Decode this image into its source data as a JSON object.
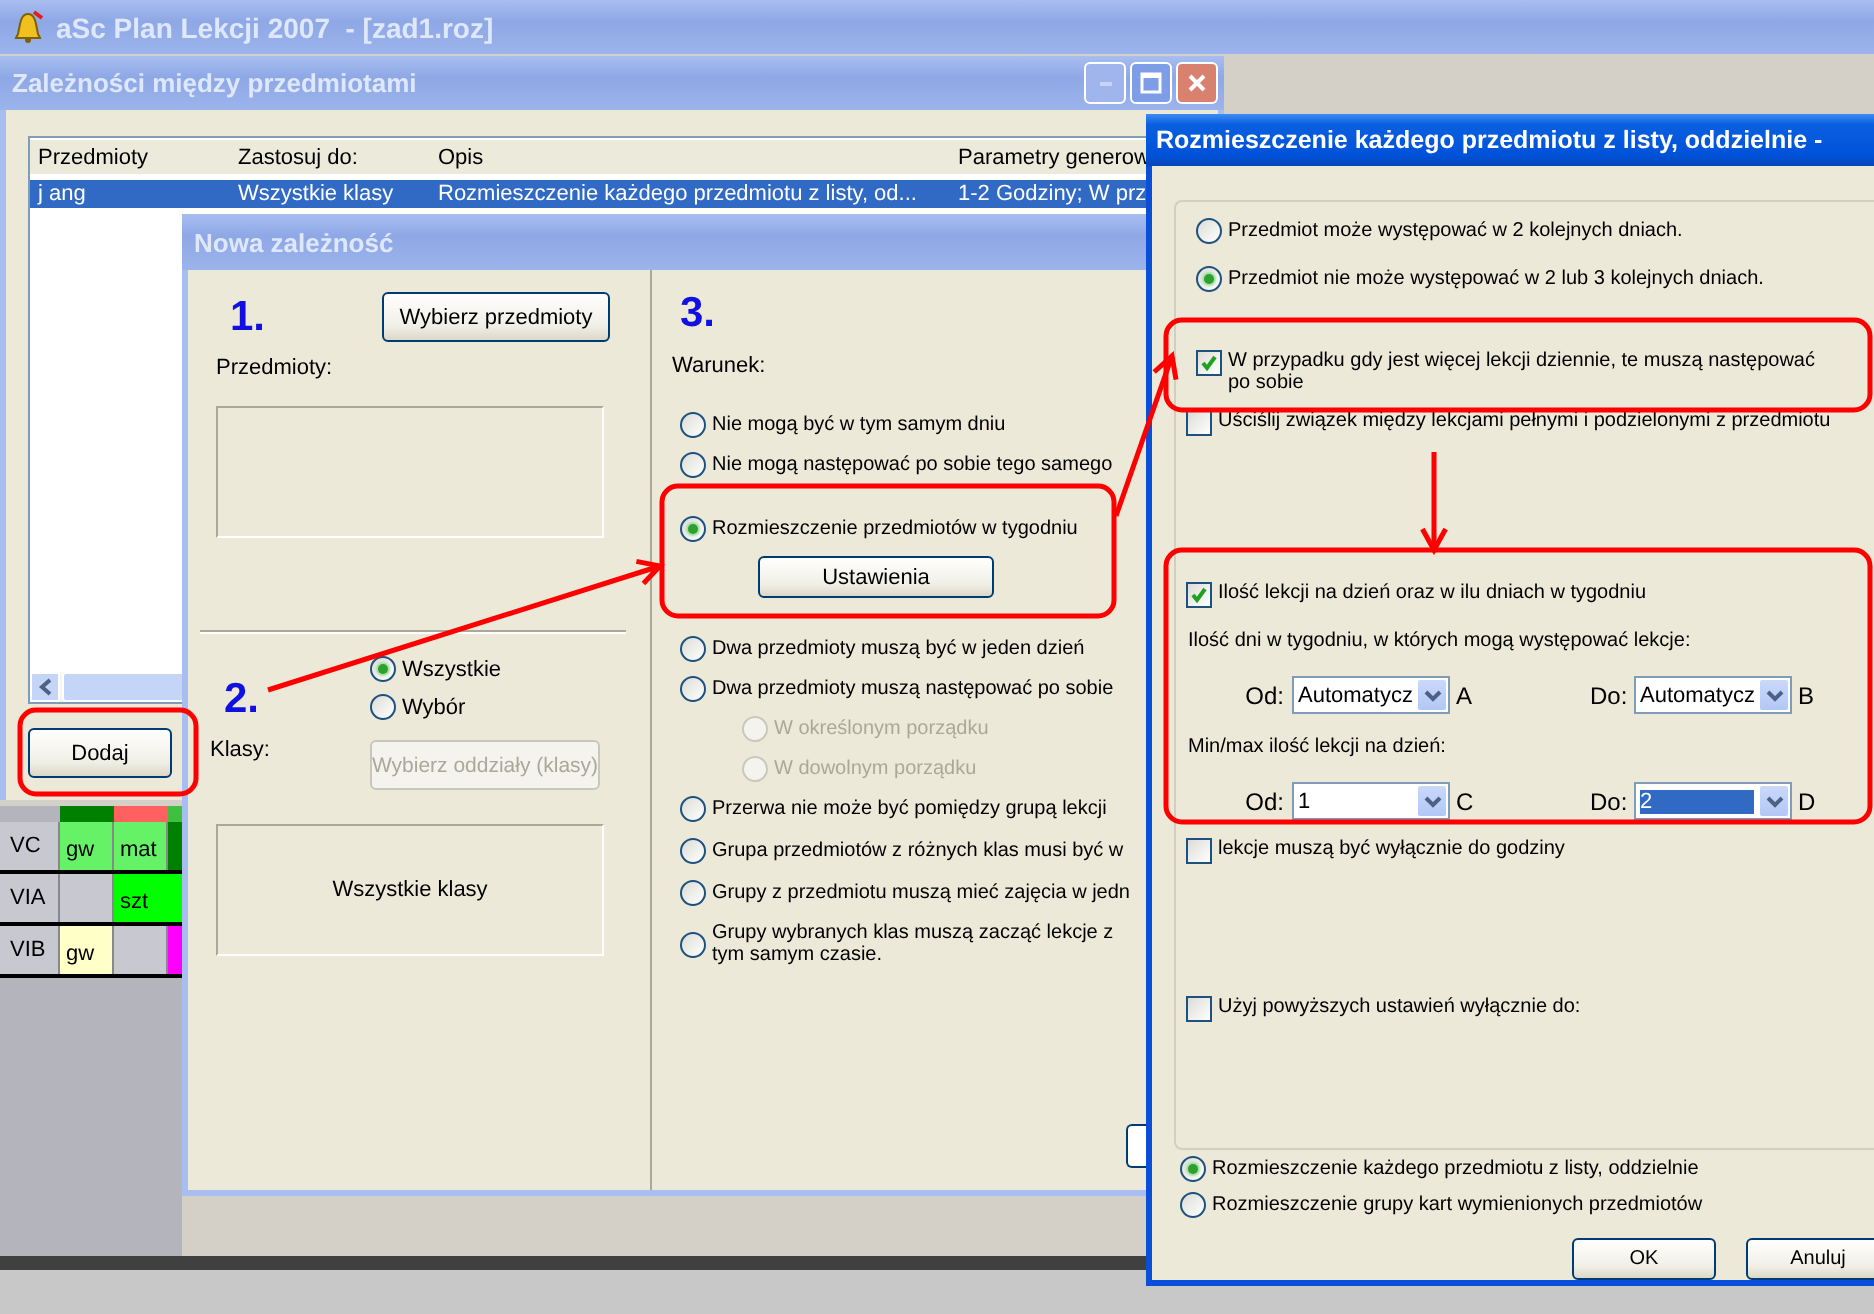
{
  "app": {
    "title": "aSc Plan Lekcji 2007  - [zad1.roz]"
  },
  "dependencies_window": {
    "title": "Zależności między przedmiotami",
    "columns": [
      "Przedmioty",
      "Zastosuj do:",
      "Opis",
      "Parametry generow"
    ],
    "rows": [
      {
        "cells": [
          "j ang",
          "Wszystkie klasy",
          "Rozmieszczenie każdego przedmiotu z listy, od...",
          "1-2 Godziny; W prz"
        ],
        "selected": true
      }
    ],
    "add_button": "Dodaj"
  },
  "timetable": {
    "header_slots": [
      {
        "color": "#008000"
      },
      {
        "color": "#ff6060"
      },
      {
        "color": "#40c040"
      }
    ],
    "rows": [
      {
        "label": "VC",
        "cells": [
          {
            "text": "gw",
            "color": "#66f266"
          },
          {
            "text": "mat",
            "color": "#66f266"
          },
          {
            "color": "#008000"
          }
        ]
      },
      {
        "label": "VIA",
        "cells": [
          {
            "color": "#c8c8d0"
          },
          {
            "text": "szt",
            "color": "#00ff00"
          }
        ]
      },
      {
        "label": "VIB",
        "cells": [
          {
            "text": "gw",
            "color": "#ffffc8"
          },
          {
            "color": "#c8c8d0"
          },
          {
            "color": "#ff00ff"
          }
        ]
      }
    ]
  },
  "new_dependency_dialog": {
    "title": "Nowa zależność",
    "step_1": "1.",
    "choose_subjects_button": "Wybierz przedmioty",
    "subjects_label": "Przedmioty:",
    "step_2": "2.",
    "class_options": [
      {
        "label": "Wszystkie",
        "selected": true
      },
      {
        "label": "Wybór",
        "selected": false
      }
    ],
    "classes_label": "Klasy:",
    "choose_classes_button": {
      "label": "Wybierz oddziały (klasy)",
      "disabled": true
    },
    "classes_box": "Wszystkie klasy",
    "step_3": "3.",
    "condition_label": "Warunek:",
    "conditions": [
      {
        "kind": "option",
        "label": "Nie mogą być w tym samym dniu",
        "selected": false,
        "disabled": false
      },
      {
        "kind": "option",
        "label": "Nie mogą następować po sobie tego samego",
        "selected": false,
        "disabled": false
      },
      {
        "kind": "option",
        "label": "Rozmieszczenie przedmiotów w tygodniu",
        "selected": true,
        "disabled": false,
        "button": "Ustawienia"
      },
      {
        "kind": "option",
        "label": "Dwa przedmioty muszą być w jeden dzień",
        "selected": false,
        "disabled": false
      },
      {
        "kind": "option",
        "label": "Dwa przedmioty muszą następować po sobie",
        "selected": false,
        "disabled": false
      },
      {
        "kind": "suboption",
        "label": "W określonym porządku",
        "selected": false,
        "disabled": true
      },
      {
        "kind": "suboption",
        "label": "W dowolnym porządku",
        "selected": false,
        "disabled": true
      },
      {
        "kind": "option",
        "label": "Przerwa nie może być pomiędzy grupą lekcji",
        "selected": false,
        "disabled": false
      },
      {
        "kind": "option",
        "label": "Grupa przedmiotów z różnych klas musi być w",
        "selected": false,
        "disabled": false
      },
      {
        "kind": "option",
        "label": "Grupy z przedmiotu muszą mieć zajęcia w jedn",
        "selected": false,
        "disabled": false
      },
      {
        "kind": "option",
        "label": "Grupy wybranych klas muszą zacząć lekcje z\ntym samym czasie.",
        "selected": false,
        "disabled": false
      }
    ]
  },
  "settings_dialog": {
    "title": "Rozmieszczenie każdego przedmiotu z listy, oddzielnie -",
    "spread_options": [
      {
        "label": "Przedmiot może występować w 2 kolejnych dniach.",
        "selected": false
      },
      {
        "label": "Przedmiot nie może występować w 2 lub 3 kolejnych dniach.",
        "selected": true
      }
    ],
    "checks": [
      {
        "label": "W przypadku gdy jest więcej lekcji dziennie, te muszą następować po sobie",
        "checked": true
      },
      {
        "label": "Uściślij związek między lekcjami pełnymi i podzielonymi z przedmiotu",
        "checked": false
      },
      {
        "label": "Ilość lekcji na dzień oraz w ilu dniach w tygodniu",
        "checked": true,
        "ranges": [
          {
            "label": "Ilość dni w tygodniu, w których mogą występować lekcje:",
            "from": {
              "label": "Od:",
              "value": "Automatycz",
              "tag": "A",
              "highlighted": false
            },
            "to": {
              "label": "Do:",
              "value": "Automatycz",
              "tag": "B",
              "highlighted": false
            }
          },
          {
            "label": "Min/max ilość lekcji na dzień:",
            "from": {
              "label": "Od:",
              "value": "1",
              "tag": "C",
              "highlighted": false
            },
            "to": {
              "label": "Do:",
              "value": "2",
              "tag": "D",
              "highlighted": true
            }
          }
        ]
      },
      {
        "label": "lekcje muszą być wyłącznie do godziny",
        "checked": false
      },
      {
        "label": "Użyj powyższych ustawień wyłącznie do:",
        "checked": false
      }
    ],
    "mode_options": [
      {
        "label": "Rozmieszczenie każdego przedmiotu z listy, oddzielnie",
        "selected": true
      },
      {
        "label": "Rozmieszczenie grupy kart wymienionych przedmiotów",
        "selected": false
      }
    ],
    "buttons": [
      "OK",
      "Anuluj"
    ]
  }
}
